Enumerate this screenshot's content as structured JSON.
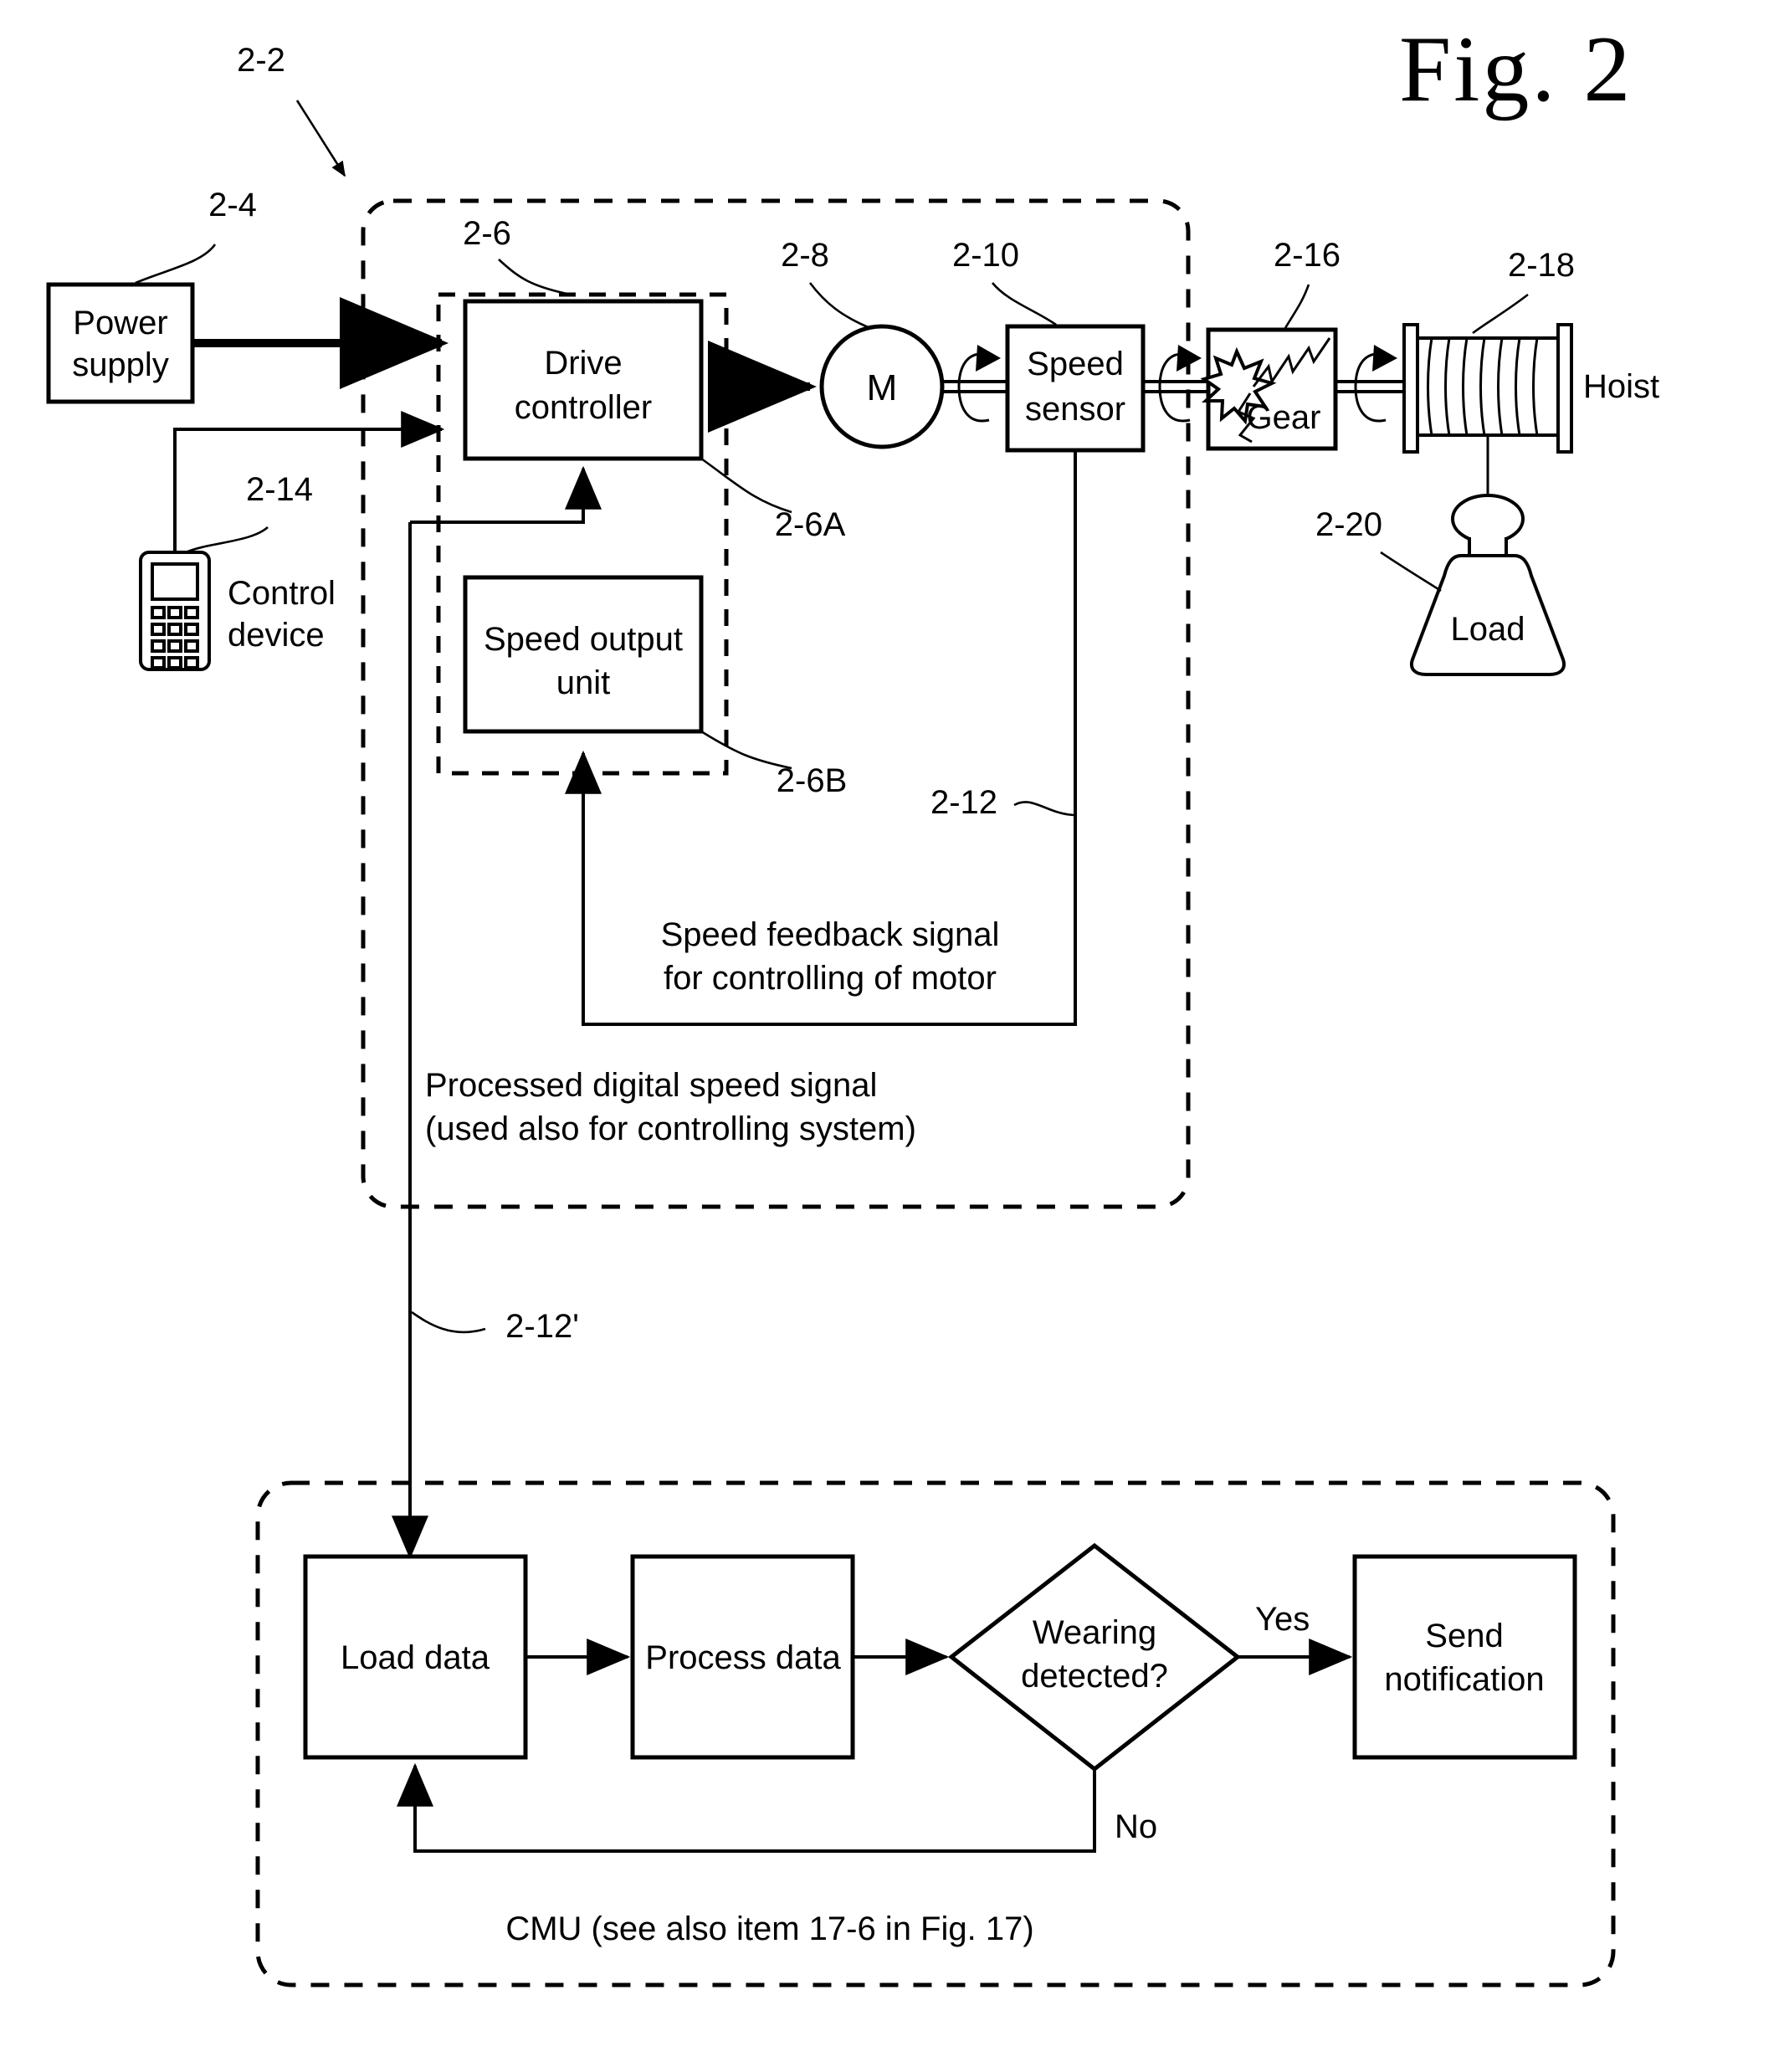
{
  "figure": {
    "title": "Fig. 2"
  },
  "blocks": {
    "power_supply": {
      "line1": "Power",
      "line2": "supply"
    },
    "control_device": {
      "line1": "Control",
      "line2": "device"
    },
    "drive_controller": {
      "line1": "Drive",
      "line2": "controller"
    },
    "speed_output_unit": {
      "line1": "Speed output",
      "line2": "unit"
    },
    "motor": {
      "label": "M"
    },
    "speed_sensor": {
      "line1": "Speed",
      "line2": "sensor"
    },
    "gear": {
      "label": "Gear"
    },
    "hoist": {
      "label": "Hoist"
    },
    "load": {
      "label": "Load"
    },
    "load_data": {
      "label": "Load data"
    },
    "process_data": {
      "label": "Process data"
    },
    "wearing_detected": {
      "line1": "Wearing",
      "line2": "detected?"
    },
    "send_notification": {
      "line1": "Send",
      "line2": "notification"
    }
  },
  "notes": {
    "speed_feedback_l1": "Speed feedback signal",
    "speed_feedback_l2": "for controlling of motor",
    "processed_signal_l1": "Processed digital speed signal",
    "processed_signal_l2": "(used also for controlling system)",
    "cmu_caption": "CMU (see also item 17-6 in Fig. 17)"
  },
  "branch_labels": {
    "yes": "Yes",
    "no": "No"
  },
  "reference_numerals": {
    "system": "2-2",
    "power_supply": "2-4",
    "drive_unit": "2-6",
    "drive_controller": "2-6A",
    "speed_output_unit": "2-6B",
    "motor": "2-8",
    "speed_sensor": "2-10",
    "speed_feedback_signal": "2-12",
    "processed_speed_signal": "2-12'",
    "control_device": "2-14",
    "gear": "2-16",
    "hoist": "2-18",
    "load": "2-20"
  },
  "colors": {
    "ink": "#000000",
    "paper": "#ffffff"
  }
}
